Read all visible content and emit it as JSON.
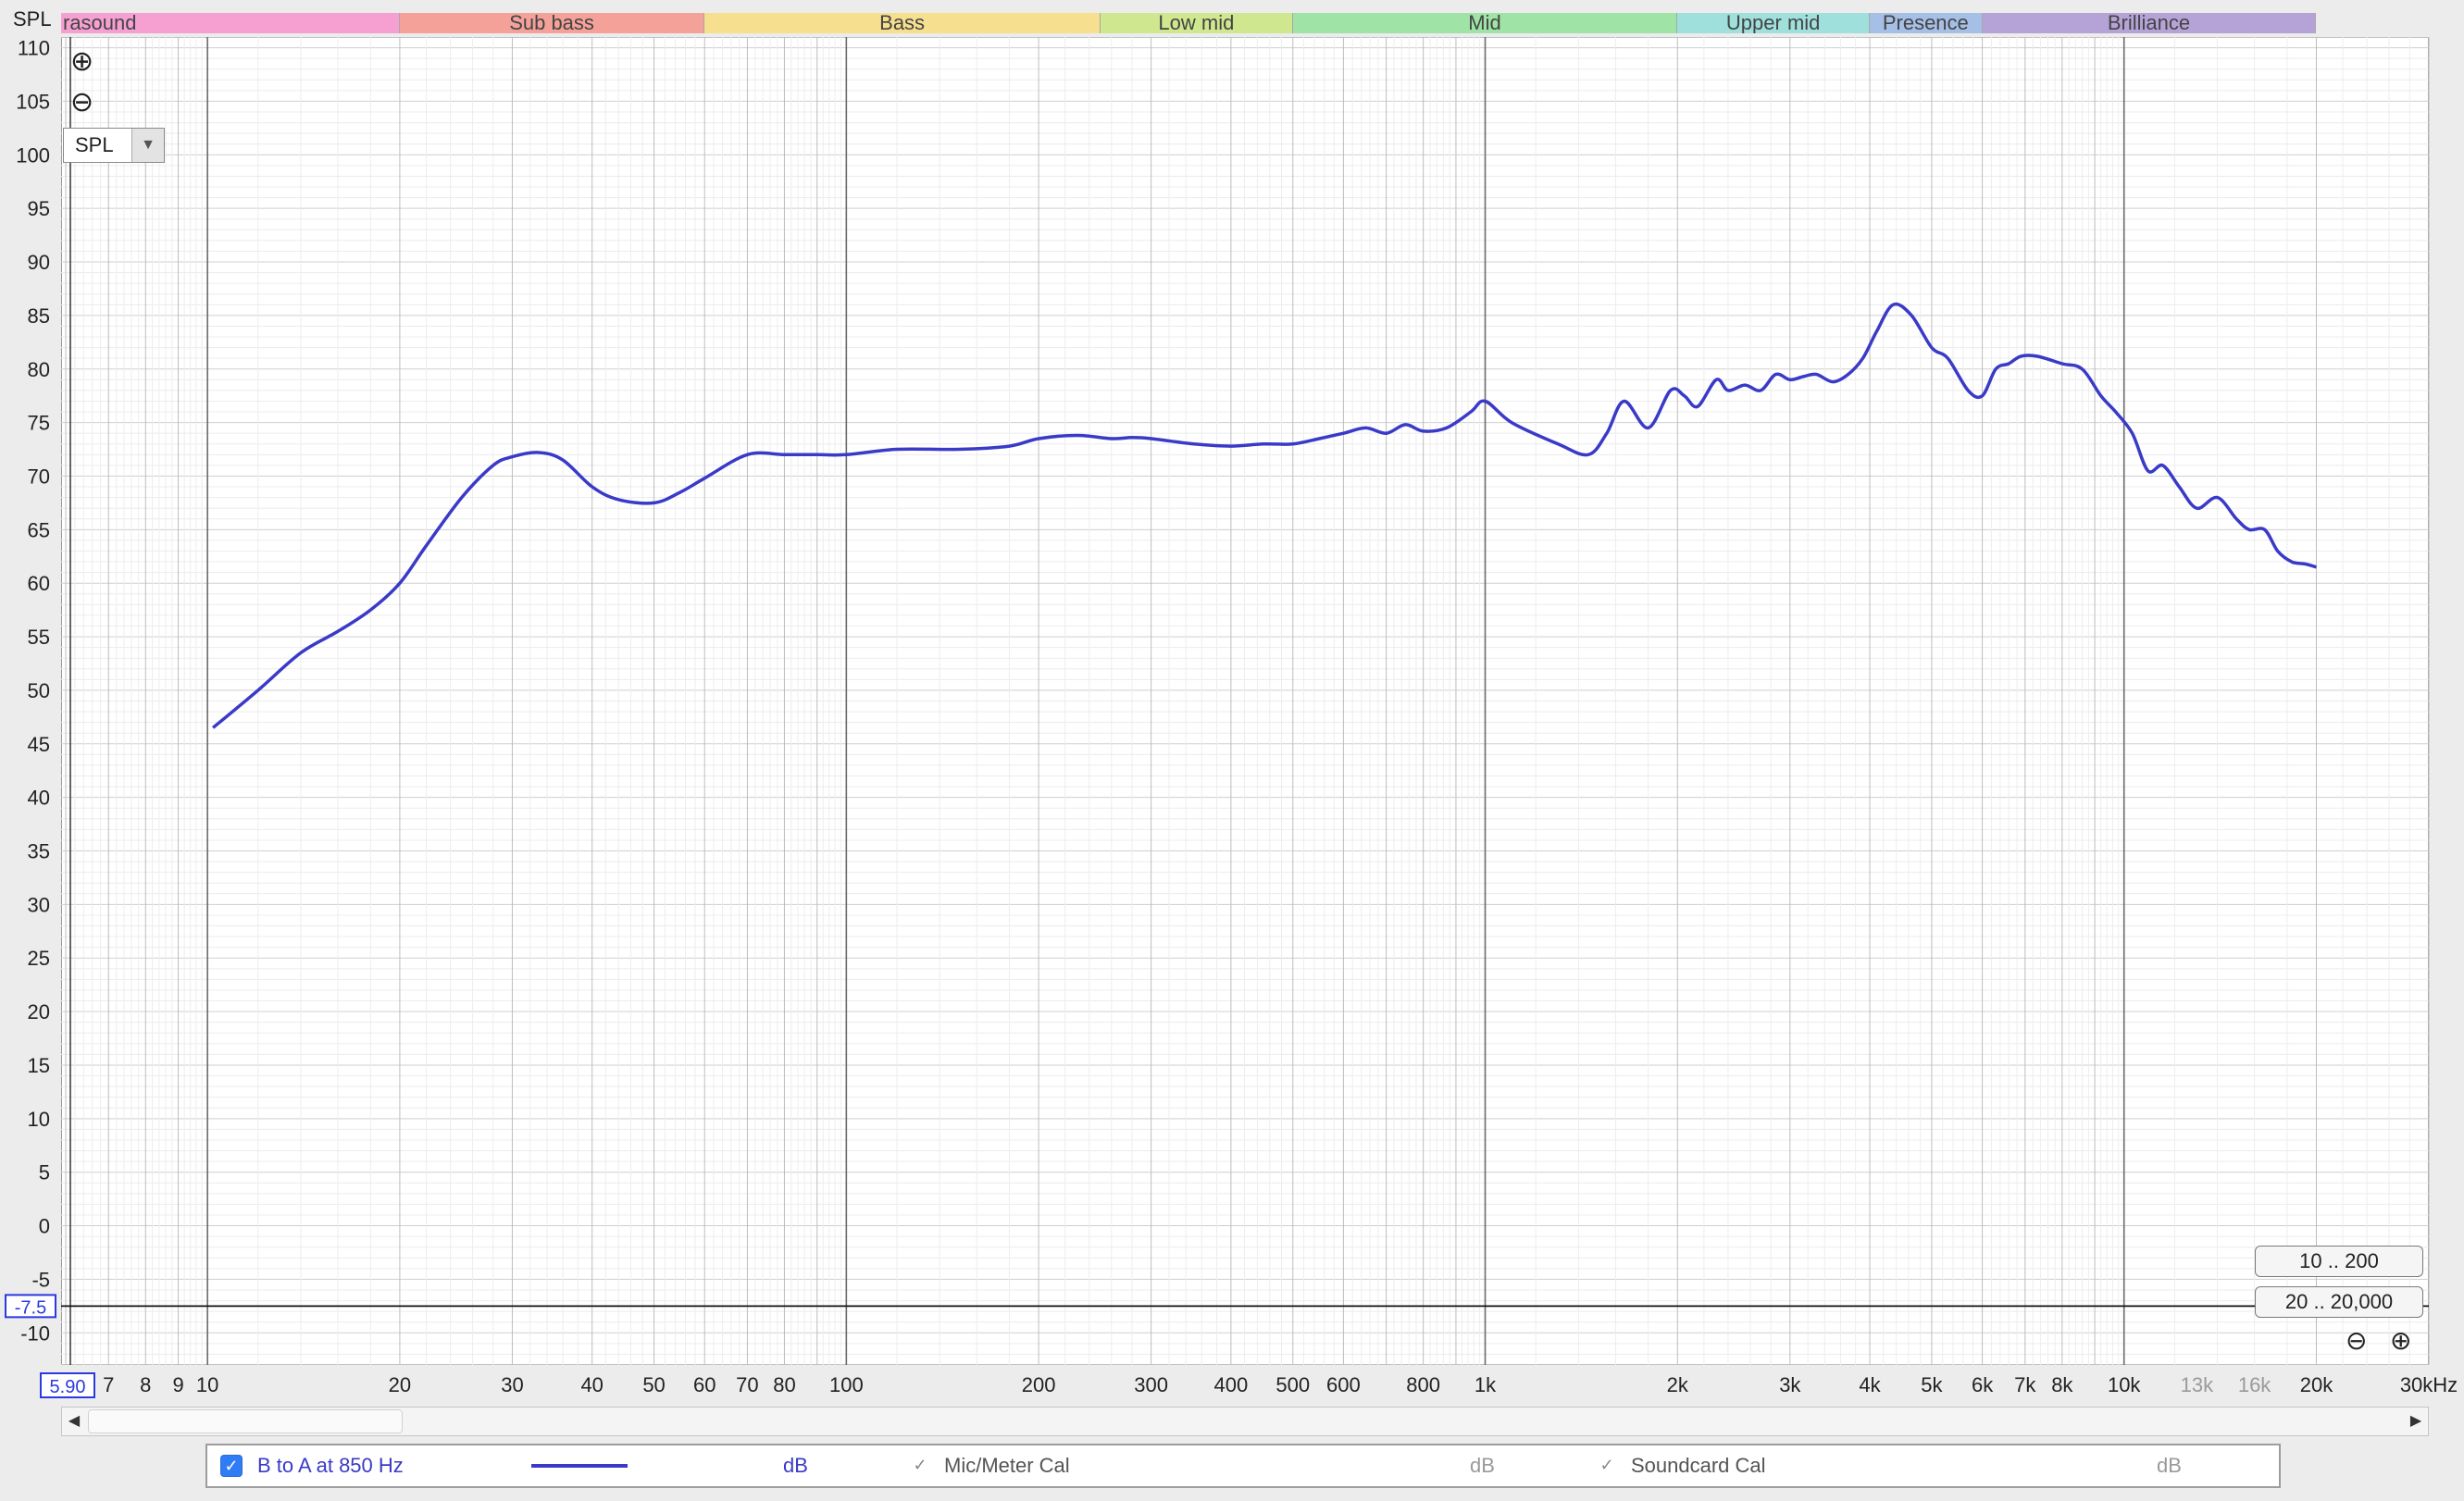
{
  "colors": {
    "curve": "#3a3ac8",
    "band_infrasound": "#f6a0d2",
    "band_sub_bass": "#f4a19a",
    "band_bass": "#f6df8f",
    "band_low_mid": "#cfe88f",
    "band_mid": "#9fe3a6",
    "band_upper_mid": "#9fe0dd",
    "band_presence": "#a6bfe6",
    "band_brilliance": "#b5a3d8",
    "cursor_label": "#2b3ae0"
  },
  "spl_tag": "SPL",
  "bands": [
    {
      "label": "rasound",
      "from": 5.9,
      "to": 20,
      "color_key": "band_infrasound",
      "align": "left"
    },
    {
      "label": "Sub bass",
      "from": 20,
      "to": 60,
      "color_key": "band_sub_bass",
      "align": "center"
    },
    {
      "label": "Bass",
      "from": 60,
      "to": 250,
      "color_key": "band_bass",
      "align": "center"
    },
    {
      "label": "Low mid",
      "from": 250,
      "to": 500,
      "color_key": "band_low_mid",
      "align": "center"
    },
    {
      "label": "Mid",
      "from": 500,
      "to": 2000,
      "color_key": "band_mid",
      "align": "center"
    },
    {
      "label": "Upper mid",
      "from": 2000,
      "to": 4000,
      "color_key": "band_upper_mid",
      "align": "center"
    },
    {
      "label": "Presence",
      "from": 4000,
      "to": 6000,
      "color_key": "band_presence",
      "align": "center"
    },
    {
      "label": "Brilliance",
      "from": 6000,
      "to": 20000,
      "color_key": "band_brilliance",
      "align": "center"
    }
  ],
  "toolbar": {
    "zoom_in_icon": "plus-circle-icon",
    "zoom_out_icon": "minus-circle-icon",
    "measure_select": "SPL",
    "range_btn_1": "10 .. 200",
    "range_btn_2": "20 .. 20,000"
  },
  "cursor": {
    "x_value": "5.90",
    "y_value": "-7.5"
  },
  "chart_data": {
    "type": "line",
    "xscale": "log",
    "xlim": [
      5.9,
      30000
    ],
    "ylim": [
      -13,
      111
    ],
    "yticks": [
      110,
      105,
      100,
      95,
      90,
      85,
      80,
      75,
      70,
      65,
      60,
      55,
      50,
      45,
      40,
      35,
      30,
      25,
      20,
      15,
      10,
      5,
      0,
      -5,
      -10
    ],
    "xticks": [
      {
        "v": 7,
        "label": "7"
      },
      {
        "v": 8,
        "label": "8"
      },
      {
        "v": 9,
        "label": "9"
      },
      {
        "v": 10,
        "label": "10"
      },
      {
        "v": 20,
        "label": "20"
      },
      {
        "v": 30,
        "label": "30"
      },
      {
        "v": 40,
        "label": "40"
      },
      {
        "v": 50,
        "label": "50"
      },
      {
        "v": 60,
        "label": "60"
      },
      {
        "v": 70,
        "label": "70"
      },
      {
        "v": 80,
        "label": "80"
      },
      {
        "v": 100,
        "label": "100"
      },
      {
        "v": 200,
        "label": "200"
      },
      {
        "v": 300,
        "label": "300"
      },
      {
        "v": 400,
        "label": "400"
      },
      {
        "v": 500,
        "label": "500"
      },
      {
        "v": 600,
        "label": "600"
      },
      {
        "v": 800,
        "label": "800"
      },
      {
        "v": 1000,
        "label": "1k"
      },
      {
        "v": 2000,
        "label": "2k"
      },
      {
        "v": 3000,
        "label": "3k"
      },
      {
        "v": 4000,
        "label": "4k"
      },
      {
        "v": 5000,
        "label": "5k"
      },
      {
        "v": 6000,
        "label": "6k"
      },
      {
        "v": 7000,
        "label": "7k"
      },
      {
        "v": 8000,
        "label": "8k"
      },
      {
        "v": 10000,
        "label": "10k"
      },
      {
        "v": 13000,
        "label": "13k",
        "dim": true
      },
      {
        "v": 16000,
        "label": "16k",
        "dim": true
      },
      {
        "v": 20000,
        "label": "20k"
      },
      {
        "v": 30000,
        "label": "30kHz"
      }
    ],
    "reference_line_y": -7.5,
    "series": [
      {
        "name": "B to A at 850 Hz",
        "x": [
          10.2,
          12,
          14,
          16,
          18,
          20,
          22,
          25,
          28,
          30,
          33,
          36,
          40,
          44,
          50,
          55,
          60,
          70,
          80,
          90,
          100,
          120,
          150,
          180,
          200,
          230,
          260,
          280,
          300,
          350,
          400,
          450,
          500,
          550,
          600,
          650,
          700,
          750,
          800,
          870,
          950,
          1000,
          1100,
          1300,
          1450,
          1550,
          1650,
          1800,
          1950,
          2050,
          2150,
          2300,
          2400,
          2550,
          2700,
          2850,
          3000,
          3150,
          3300,
          3500,
          3700,
          3900,
          4100,
          4350,
          4650,
          5000,
          5300,
          5700,
          6000,
          6300,
          6600,
          6900,
          7300,
          8000,
          8600,
          9200,
          9700,
          10300,
          10900,
          11500,
          12200,
          13000,
          14000,
          15000,
          15700,
          16600,
          17400,
          18300,
          19200,
          20000
        ],
        "y": [
          46.5,
          50,
          53.5,
          55.5,
          57.5,
          60,
          63.5,
          68,
          71,
          71.8,
          72.2,
          71.5,
          69,
          67.8,
          67.5,
          68.5,
          69.8,
          72,
          72,
          72,
          72,
          72.5,
          72.5,
          72.8,
          73.5,
          73.8,
          73.5,
          73.6,
          73.5,
          73,
          72.8,
          73,
          73,
          73.5,
          74,
          74.5,
          74,
          74.8,
          74.2,
          74.5,
          76,
          77,
          75,
          73,
          72,
          74,
          77,
          74.5,
          78,
          77.5,
          76.5,
          79,
          78,
          78.5,
          78,
          79.5,
          79,
          79.3,
          79.5,
          78.8,
          79.5,
          81,
          83.5,
          86,
          85,
          82,
          81,
          78,
          77.5,
          80,
          80.5,
          81.2,
          81.2,
          80.5,
          80,
          77.5,
          76,
          74,
          70.5,
          71,
          69,
          67,
          68,
          66,
          65,
          65,
          63,
          62,
          61.8,
          61.5
        ]
      }
    ]
  },
  "legend": {
    "series_label": "B to A at 850 Hz",
    "series_unit": "dB",
    "mic_label": "Mic/Meter Cal",
    "mic_unit": "dB",
    "soundcard_label": "Soundcard Cal",
    "soundcard_unit": "dB"
  }
}
